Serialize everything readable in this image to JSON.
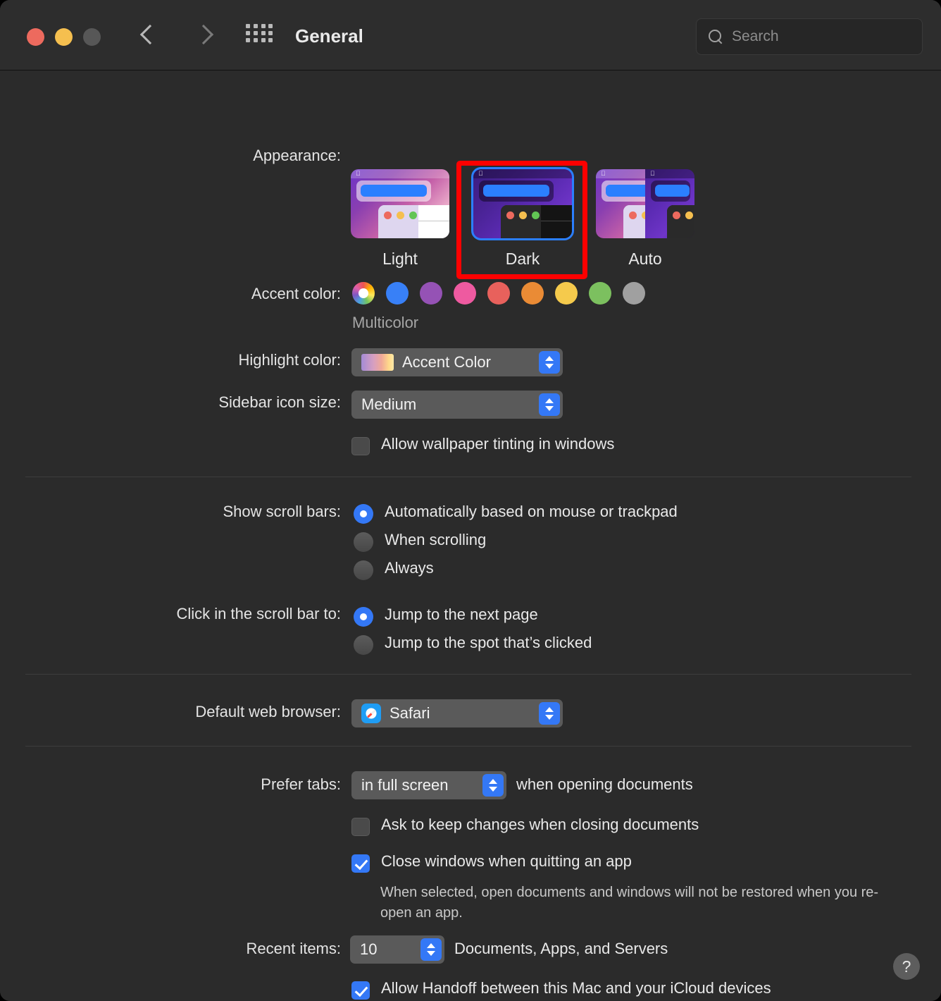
{
  "window": {
    "title": "General",
    "traffic_lights": [
      "close",
      "minimize",
      "zoom"
    ],
    "nav_back": "back",
    "nav_forward": "forward",
    "grid_button": "show-all",
    "search": {
      "placeholder": "Search",
      "value": ""
    }
  },
  "appearance": {
    "label": "Appearance:",
    "options": [
      {
        "name": "Light",
        "selected": false
      },
      {
        "name": "Dark",
        "selected": true
      },
      {
        "name": "Auto",
        "selected": false
      }
    ],
    "highlight_color": "#fe0000",
    "selection_ring_color": "#2b7fff"
  },
  "accent_color": {
    "label": "Accent color:",
    "selected_name": "Multicolor",
    "swatches": [
      {
        "name": "Multicolor",
        "color": "multicolor",
        "selected": true
      },
      {
        "name": "Blue",
        "color": "#3880f7"
      },
      {
        "name": "Purple",
        "color": "#9552b5"
      },
      {
        "name": "Pink",
        "color": "#ee5aa0"
      },
      {
        "name": "Red",
        "color": "#e8615c"
      },
      {
        "name": "Orange",
        "color": "#ea8b35"
      },
      {
        "name": "Yellow",
        "color": "#f5ca4c"
      },
      {
        "name": "Green",
        "color": "#7cc05f"
      },
      {
        "name": "Graphite",
        "color": "#a0a0a0"
      }
    ]
  },
  "highlight_color": {
    "label": "Highlight color:",
    "value": "Accent Color",
    "swatch_gradient": "#a48bd6 → #ffe9a8"
  },
  "sidebar_icon_size": {
    "label": "Sidebar icon size:",
    "value": "Medium"
  },
  "wallpaper_tinting": {
    "label": "Allow wallpaper tinting in windows",
    "checked": false
  },
  "scroll_bars": {
    "label": "Show scroll bars:",
    "options": [
      {
        "label": "Automatically based on mouse or trackpad",
        "selected": true
      },
      {
        "label": "When scrolling",
        "selected": false
      },
      {
        "label": "Always",
        "selected": false
      }
    ]
  },
  "scroll_bar_click": {
    "label": "Click in the scroll bar to:",
    "options": [
      {
        "label": "Jump to the next page",
        "selected": true
      },
      {
        "label": "Jump to the spot that’s clicked",
        "selected": false
      }
    ]
  },
  "default_browser": {
    "label": "Default web browser:",
    "value": "Safari",
    "icon": "safari-icon"
  },
  "prefer_tabs": {
    "label": "Prefer tabs:",
    "value": "in full screen",
    "suffix": "when opening documents"
  },
  "ask_keep_changes": {
    "label": "Ask to keep changes when closing documents",
    "checked": false
  },
  "close_windows": {
    "label": "Close windows when quitting an app",
    "checked": true,
    "description": "When selected, open documents and windows will not be restored when you re-open an app."
  },
  "recent_items": {
    "label": "Recent items:",
    "value": "10",
    "suffix": "Documents, Apps, and Servers"
  },
  "handoff": {
    "label": "Allow Handoff between this Mac and your iCloud devices",
    "checked": true
  },
  "help_button": {
    "glyph": "?"
  }
}
